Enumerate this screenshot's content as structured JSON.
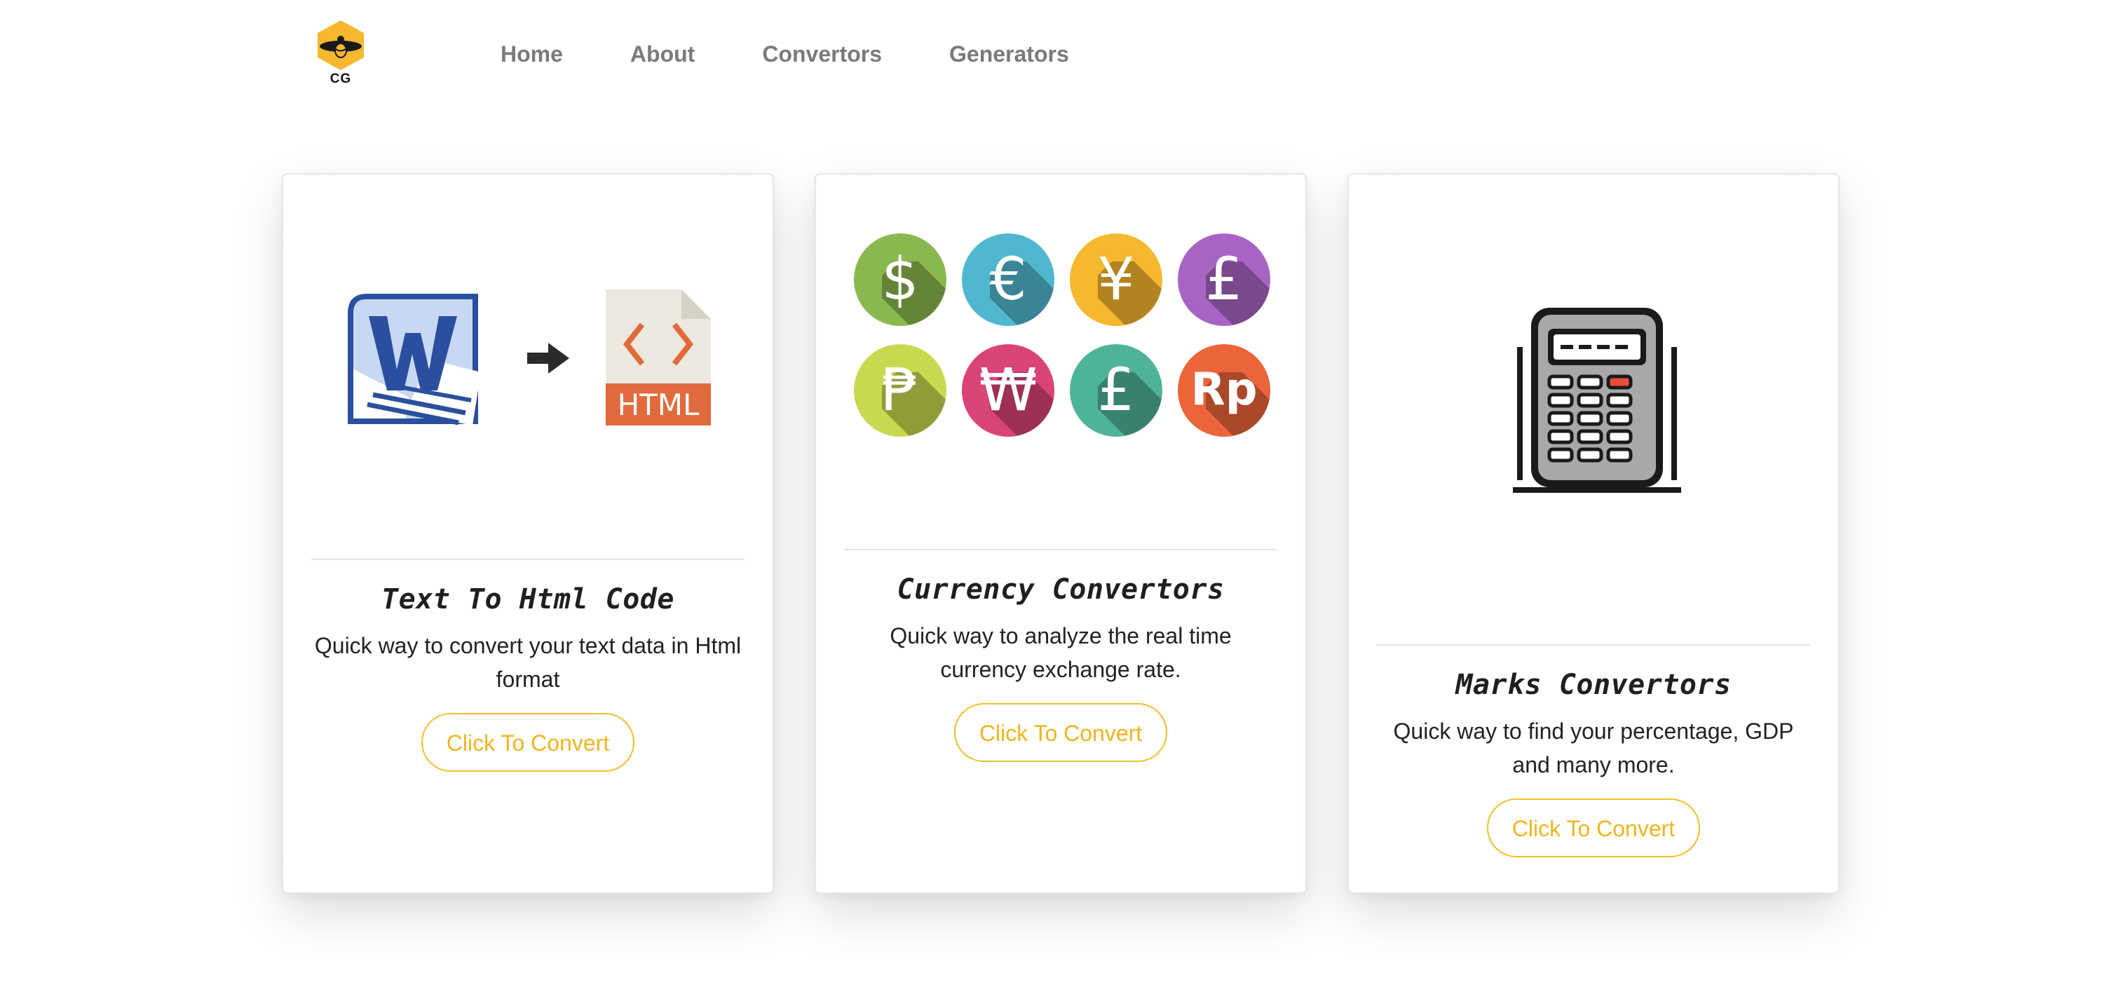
{
  "nav": {
    "logo_text": "CG",
    "links": [
      {
        "label": "Home"
      },
      {
        "label": "About"
      },
      {
        "label": "Convertors"
      },
      {
        "label": "Generators"
      }
    ]
  },
  "cards": [
    {
      "image_icons": [
        "word-document-icon",
        "arrow-right-icon",
        "html-file-icon"
      ],
      "html_label": "HTML",
      "title": "Text To Html Code",
      "text": "Quick way to convert your text data in Html format",
      "button": "Click To Convert"
    },
    {
      "image_icons": [
        "dollar-coin-icon",
        "euro-coin-icon",
        "yen-coin-icon",
        "pound-coin-icon",
        "peso-coin-icon",
        "won-coin-icon",
        "pound-coin-icon",
        "rupiah-coin-icon"
      ],
      "coins": [
        {
          "symbol": "$",
          "color": "#8bb84e"
        },
        {
          "symbol": "€",
          "color": "#4fb8cf"
        },
        {
          "symbol": "¥",
          "color": "#f5b82e"
        },
        {
          "symbol": "£",
          "color": "#a864c4"
        },
        {
          "symbol": "₱",
          "color": "#c9d94f"
        },
        {
          "symbol": "₩",
          "color": "#d94474"
        },
        {
          "symbol": "£",
          "color": "#4fb39a"
        },
        {
          "symbol": "Rp",
          "color": "#ec6439"
        }
      ],
      "title": "Currency Convertors",
      "text": "Quick way to analyze the real time currency exchange rate.",
      "button": "Click To Convert"
    },
    {
      "image_icons": [
        "calculator-icon"
      ],
      "title": "Marks Convertors",
      "text": "Quick way to find your percentage, GDP and many more.",
      "button": "Click To Convert"
    }
  ],
  "colors": {
    "accent": "#f2be2a",
    "nav_text": "#7a7a7a",
    "word_blue": "#2a4f9e",
    "html_orange": "#e06a3b"
  }
}
